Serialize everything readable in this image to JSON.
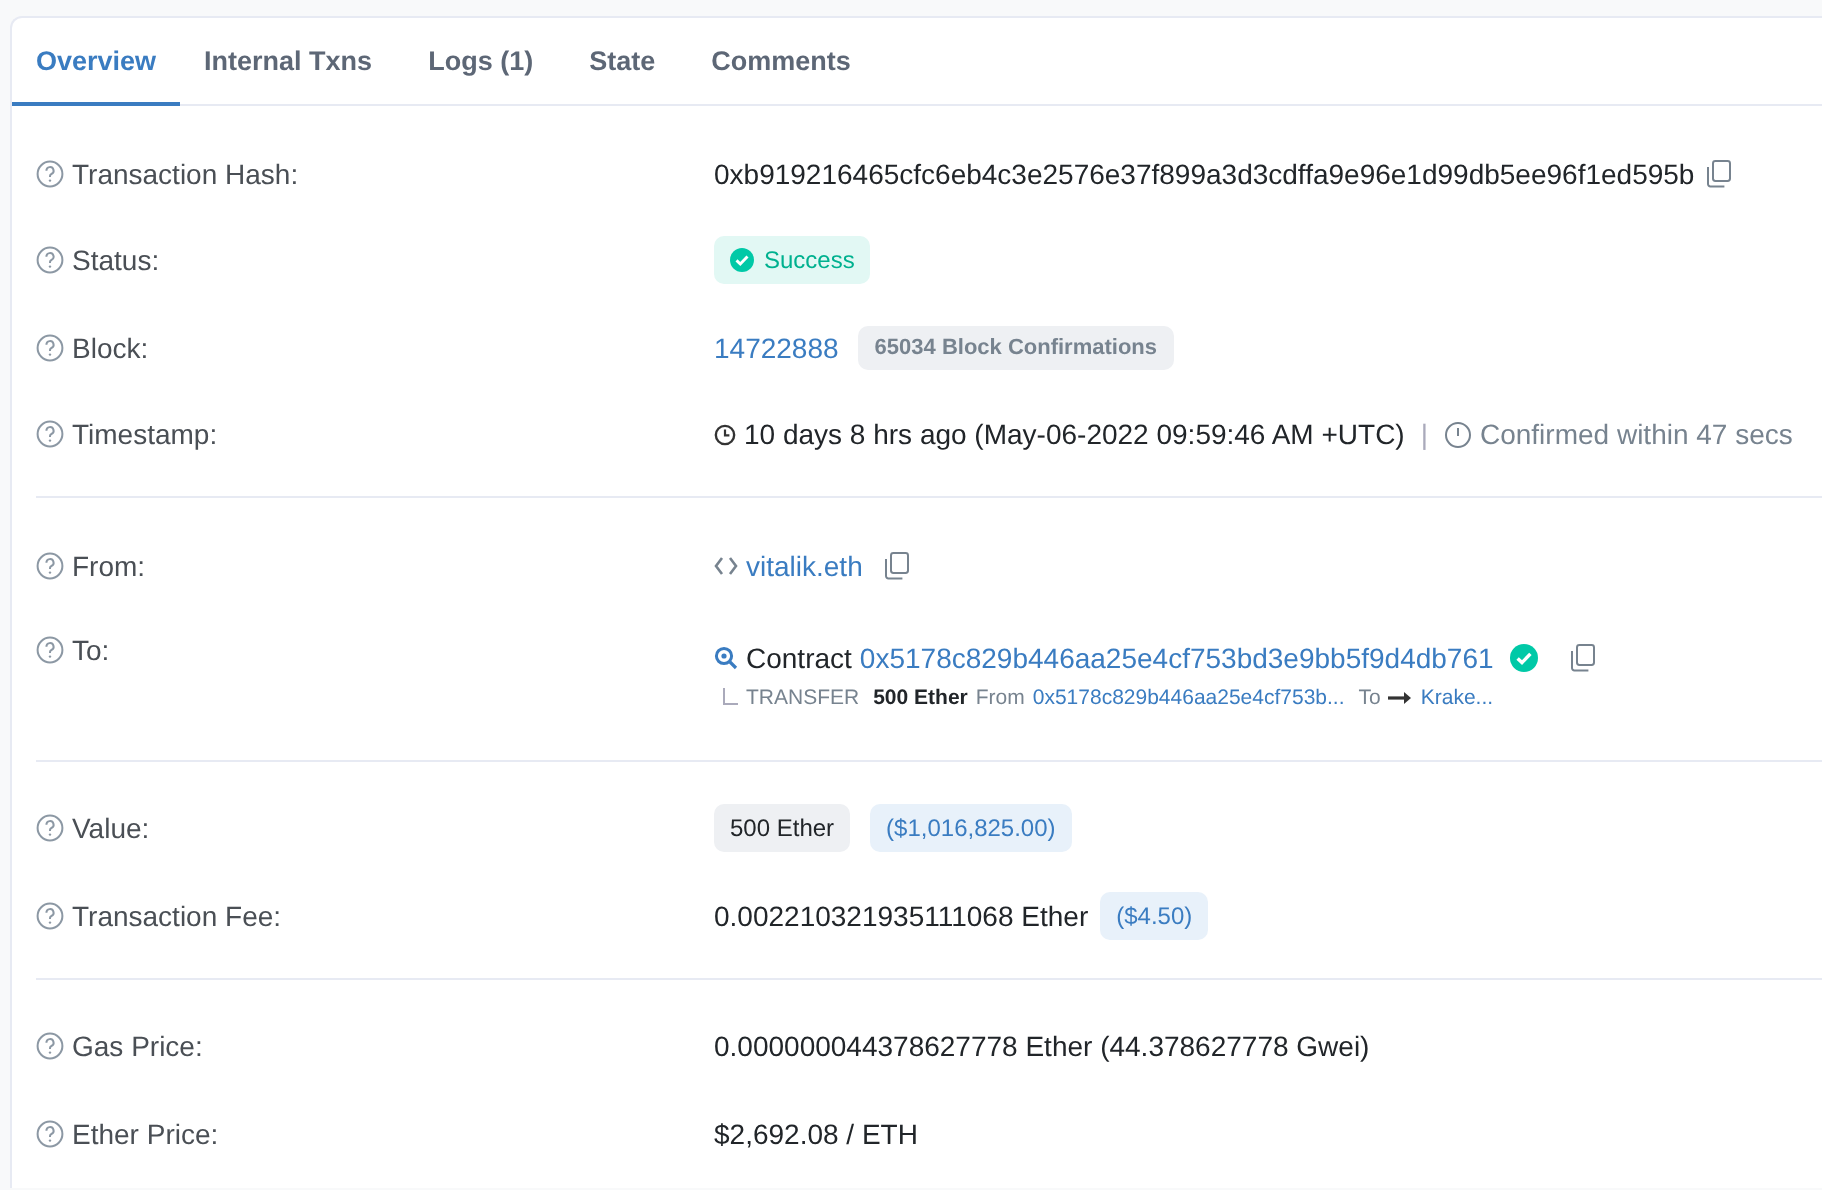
{
  "tabs": [
    {
      "label": "Overview",
      "selected": true
    },
    {
      "label": "Internal Txns",
      "selected": false
    },
    {
      "label": "Logs (1)",
      "selected": false
    },
    {
      "label": "State",
      "selected": false
    },
    {
      "label": "Comments",
      "selected": false
    }
  ],
  "sections": [
    {
      "rows": [
        {
          "kind": "hash",
          "label": "Transaction Hash:",
          "value": "0xb919216465cfc6eb4c3e2576e37f899a3d3cdffa9e96e1d99db5ee96f1ed595b"
        },
        {
          "kind": "status",
          "label": "Status:",
          "status": "Success"
        },
        {
          "kind": "block",
          "label": "Block:",
          "block": "14722888",
          "confirmations": "65034 Block Confirmations"
        },
        {
          "kind": "timestamp",
          "label": "Timestamp:",
          "time": "10 days 8 hrs ago (May-06-2022 09:59:46 AM +UTC)",
          "separator": "|",
          "confirmed": "Confirmed within 47 secs"
        }
      ]
    },
    {
      "rows": [
        {
          "kind": "address",
          "label": "From:",
          "name": "vitalik.eth"
        },
        {
          "kind": "contract",
          "label": "To:",
          "prefix": "Contract",
          "address": "0x5178c829b446aa25e4cf753bd3e9bb5f9d4db761",
          "verified": true,
          "transfer": {
            "type": "TRANSFER",
            "amount": "500 Ether",
            "from_label": "From",
            "from": "0x5178c829b446aa25e4cf753b...",
            "to_label": "To",
            "to": "Krake..."
          }
        }
      ]
    },
    {
      "rows": [
        {
          "kind": "value",
          "label": "Value:",
          "amount": "500 Ether",
          "usd": "($1,016,825.00)"
        },
        {
          "kind": "fee",
          "label": "Transaction Fee:",
          "amount": "0.002210321935111068 Ether",
          "usd": "($4.50)"
        }
      ]
    },
    {
      "rows": [
        {
          "kind": "text",
          "label": "Gas Price:",
          "value": "0.000000044378627778 Ether (44.378627778 Gwei)"
        },
        {
          "kind": "text",
          "label": "Ether Price:",
          "value": "$2,692.08 / ETH"
        }
      ]
    }
  ]
}
